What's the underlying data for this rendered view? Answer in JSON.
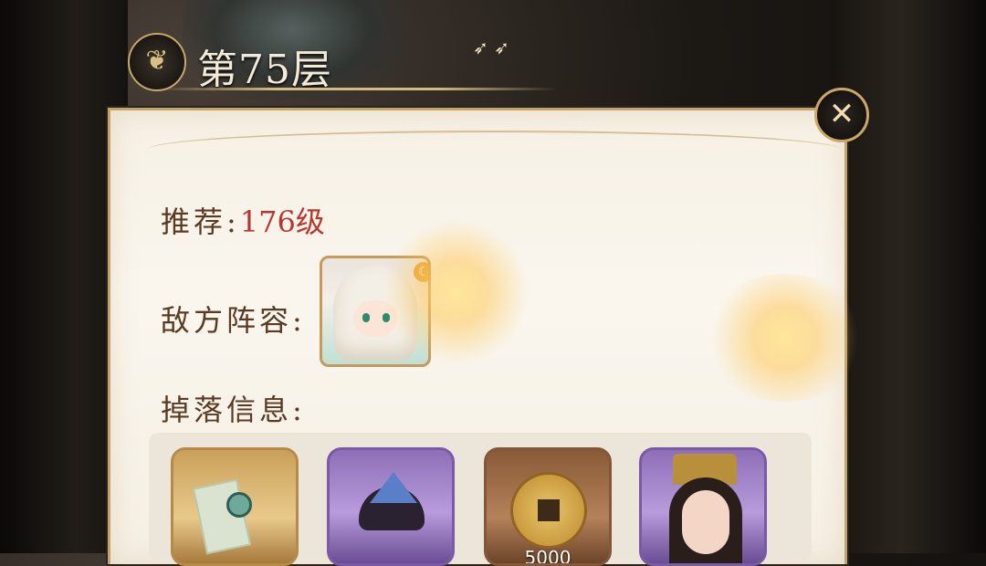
{
  "title": {
    "floor_label": "第75层",
    "emblem_glyph": "❦"
  },
  "close": {
    "glyph": "✕"
  },
  "recommend": {
    "label": "推荐:",
    "value": "176级"
  },
  "enemy": {
    "label": "敌方阵容:",
    "badge_glyph": "☾"
  },
  "drops": {
    "label": "掉落信息:",
    "items": [
      {
        "name": "jade-token",
        "rarity": "gold",
        "count": ""
      },
      {
        "name": "ink-stone",
        "rarity": "purple",
        "count": ""
      },
      {
        "name": "copper-coin",
        "rarity": "bronze",
        "count": "5000"
      },
      {
        "name": "general-portrait",
        "rarity": "purple",
        "count": ""
      }
    ]
  },
  "colors": {
    "accent_gold": "#c9a86a",
    "level_red": "#b8362f",
    "label_brown": "#5a3a22"
  }
}
